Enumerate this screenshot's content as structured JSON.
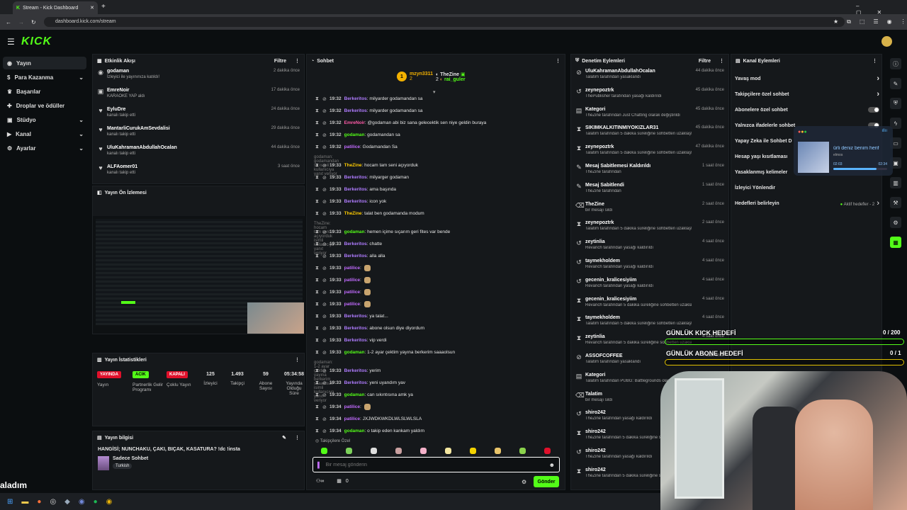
{
  "browser": {
    "tab_title": "Stream - Kick Dashboard",
    "url": "dashboard.kick.com/stream"
  },
  "app": {
    "logo": "KICK"
  },
  "nav": [
    {
      "label": "Yayın",
      "chev": ""
    },
    {
      "label": "Para Kazanma",
      "chev": "⌄"
    },
    {
      "label": "Başarılar",
      "chev": ""
    },
    {
      "label": "Droplar ve ödüller",
      "chev": ""
    },
    {
      "label": "Stüdyo",
      "chev": "⌄"
    },
    {
      "label": "Kanal",
      "chev": "⌄"
    },
    {
      "label": "Ayarlar",
      "chev": "⌄"
    }
  ],
  "activity": {
    "title": "Etkinlik Akışı",
    "filter": "Filtre",
    "items": [
      {
        "name": "godaman",
        "sub": "İzleyici ile yayınınıza katıldı!",
        "time": "2 dakika önce"
      },
      {
        "name": "EmreNoir",
        "sub": "KARAOKE YAP aldı",
        "time": "17 dakika önce"
      },
      {
        "name": "EyluDre",
        "sub": "kanalı takip etti",
        "time": "24 dakika önce"
      },
      {
        "name": "MantarliCurukAmSevdalisi",
        "sub": "kanalı takip etti",
        "time": "29 dakika önce"
      },
      {
        "name": "UluKahramanAbdullahOcalan",
        "sub": "kanalı takip etti",
        "time": "44 dakika önce"
      },
      {
        "name": "ALFAomer01",
        "sub": "kanalı takip etti",
        "time": "3 saat önce"
      }
    ]
  },
  "preview": {
    "title": "Yayın Ön İzlemesi"
  },
  "stats": {
    "title": "Yayın İstatistikleri",
    "items": [
      {
        "value": "YAYINDA",
        "label": "Yayın",
        "type": "red"
      },
      {
        "value": "ACIK",
        "label": "Partnerlik Gelir Programı",
        "type": "green"
      },
      {
        "value": "KAPALI",
        "label": "Çoklu Yayın",
        "type": "red"
      },
      {
        "value": "125",
        "label": "İzleyici",
        "type": "num"
      },
      {
        "value": "1.493",
        "label": "Takipçi",
        "type": "num"
      },
      {
        "value": "59",
        "label": "Abone Sayısı",
        "type": "num"
      },
      {
        "value": "05:34:58",
        "label": "Yayında Olduğu Süre",
        "type": "num"
      }
    ]
  },
  "info": {
    "title": "Yayın bilgisi",
    "stream_title": "HANGİSİ; NUNCHAKU, ÇAKI, BIÇAK, KASATURA? !dc !insta",
    "category": "Sadece Sohbet",
    "tag": "Turkish"
  },
  "chat": {
    "title": "Sohbet",
    "top1_name": "mzyn3311",
    "top1_count": "2",
    "top2_name": "TheZine",
    "top2_count": "2",
    "top3_name": "rai_guler",
    "top3_count": "2",
    "messages": [
      {
        "time": "19:32",
        "user": "Berkeritos",
        "color": "#b07cff",
        "text": ": milyarder godamandan sa"
      },
      {
        "time": "19:32",
        "user": "Berkeritos",
        "color": "#b07cff",
        "text": ": milyarder godamandan sa"
      },
      {
        "time": "19:32",
        "user": "EmreNoir",
        "color": "#ff5ba8",
        "text": ": @godaman abi biz sana gelecektik sen niye geldin buraya"
      },
      {
        "time": "19:32",
        "user": "godaman",
        "color": "#53fc18",
        "text": ": godamandan sa"
      },
      {
        "time": "19:32",
        "user": "patilice",
        "color": "#c26bff",
        "text": ": Godamandan Sa"
      },
      {
        "sys": "godaman: godamandan sa isimli kullanıcıya yanıt veriyor"
      },
      {
        "time": "19:33",
        "user": "TheZine",
        "color": "#ffcc00",
        "text": ": hocam tam seni açıyorduk"
      },
      {
        "time": "19:33",
        "user": "Berkeritos",
        "color": "#b07cff",
        "text": ": milyarger godaman"
      },
      {
        "time": "19:33",
        "user": "Berkeritos",
        "color": "#b07cff",
        "text": ": ama başında"
      },
      {
        "time": "19:33",
        "user": "Berkeritos",
        "color": "#b07cff",
        "text": ": icon yok"
      },
      {
        "time": "19:33",
        "user": "TheZine",
        "color": "#ffcc00",
        "text": ": talat ben godamanda modum"
      },
      {
        "sys": "TheZine: hocam tam seni açıyorduk isimli kullanıcıya yanıt veriyor"
      },
      {
        "time": "19:33",
        "user": "godaman",
        "color": "#53fc18",
        "text": ": hemen içime sıçarım geri fites var bende"
      },
      {
        "time": "19:33",
        "user": "Berkeritos",
        "color": "#b07cff",
        "text": ": chatte"
      },
      {
        "time": "19:33",
        "user": "Berkeritos",
        "color": "#b07cff",
        "text": ": alla alla"
      },
      {
        "time": "19:33",
        "user": "patilice",
        "color": "#c26bff",
        "text": ":"
      },
      {
        "time": "19:33",
        "user": "patilice",
        "color": "#c26bff",
        "text": ":"
      },
      {
        "time": "19:33",
        "user": "patilice",
        "color": "#c26bff",
        "text": ":"
      },
      {
        "time": "19:33",
        "user": "patilice",
        "color": "#c26bff",
        "text": ":"
      },
      {
        "time": "19:33",
        "user": "Berkeritos",
        "color": "#b07cff",
        "text": ": ya talat..."
      },
      {
        "time": "19:33",
        "user": "Berkeritos",
        "color": "#b07cff",
        "text": ": abone olsun diye diyordum"
      },
      {
        "time": "19:33",
        "user": "Berkeritos",
        "color": "#b07cff",
        "text": ": vip verdi"
      },
      {
        "time": "19:33",
        "user": "godaman",
        "color": "#53fc18",
        "text": ": 1-2 ayar çektim yayına berkerim saaaolsun"
      },
      {
        "sys": "godaman: 1-2 ayar çektim yayına berkerim saaaolsun isimli kullanıcıya yanıt veriyor"
      },
      {
        "time": "19:33",
        "user": "Berkeritos",
        "color": "#b07cff",
        "text": ": yerim"
      },
      {
        "time": "19:33",
        "user": "Berkeritos",
        "color": "#b07cff",
        "text": ": yeni uyandım yav"
      },
      {
        "time": "19:33",
        "user": "godaman",
        "color": "#53fc18",
        "text": ": can sıkıntısına amk ya"
      },
      {
        "time": "19:34",
        "user": "patilice",
        "color": "#c26bff",
        "text": ":"
      },
      {
        "time": "19:34",
        "user": "patilice",
        "color": "#c26bff",
        "text": ": JXJWDKWKDLWLSLWLSLA"
      },
      {
        "time": "19:34",
        "user": "godaman",
        "color": "#53fc18",
        "text": ": o takip eden kankam yaldım"
      }
    ],
    "followers_only": "Takipçilere Özel",
    "input_placeholder": "Bir mesaj gönderin",
    "send": "Gönder",
    "count1": "0",
    "count2": "0"
  },
  "mod": {
    "title": "Denetim Eylemleri",
    "filter": "Filtre",
    "items": [
      {
        "name": "UluKahramanAbdullahOcalan",
        "sub": "Talatim tarafından yasaklandı",
        "time": "44 dakika önce",
        "icon": "⊘"
      },
      {
        "name": "zeynepoztrk",
        "sub": "ThePublisher tarafından yasağı kaldırıldı",
        "time": "45 dakika önce",
        "icon": "↺"
      },
      {
        "name": "Kategori",
        "sub": "TheZine tarafından Just Chatting olarak değiştirildi",
        "time": "45 dakika önce",
        "icon": "▤"
      },
      {
        "name": "SIKIMKALKITINMIYOKIZLAR31",
        "sub": "Talatim tarafından 5 dakika süreliğine sohbetten uzaklaştırıldı",
        "time": "45 dakika önce",
        "icon": "⧗"
      },
      {
        "name": "zeynepoztrk",
        "sub": "Talatim tarafından 5 dakika süreliğine sohbetten uzaklaştırıldı",
        "time": "47 dakika önce",
        "icon": "⧗"
      },
      {
        "name": "Mesaj Sabitlemesi Kaldırıldı",
        "sub": "TheZine tarafından",
        "time": "1 saat önce",
        "icon": "✎"
      },
      {
        "name": "Mesaj Sabitlendi",
        "sub": "TheZine tarafından",
        "time": "1 saat önce",
        "icon": "✎"
      },
      {
        "name": "TheZine",
        "sub": "bir mesajı sildi",
        "time": "2 saat önce",
        "icon": "🗑"
      },
      {
        "name": "zeynepoztrk",
        "sub": "Talatim tarafından 5 dakika süreliğine sohbetten uzaklaştırıldı",
        "time": "2 saat önce",
        "icon": "⧗"
      },
      {
        "name": "zeytinlia",
        "sub": "Revanch tarafından yasağı kaldırıldı",
        "time": "4 saat önce",
        "icon": "↺"
      },
      {
        "name": "taymekholdem",
        "sub": "Revanch tarafından yasağı kaldırıldı",
        "time": "4 saat önce",
        "icon": "↺"
      },
      {
        "name": "gecenin_kralicesiyiim",
        "sub": "Revanch tarafından yasağı kaldırıldı",
        "time": "4 saat önce",
        "icon": "↺"
      },
      {
        "name": "gecenin_kralicesiyiim",
        "sub": "Revanch tarafından 5 dakika süreliğine sohbetten uzaklaştırıldı",
        "time": "4 saat önce",
        "icon": "⧗"
      },
      {
        "name": "taymekholdem",
        "sub": "Talatim tarafından 5 dakika süreliğine sohbetten uzaklaştırıldı",
        "time": "4 saat önce",
        "icon": "⧗"
      },
      {
        "name": "zeytinlia",
        "sub": "Revanch tarafından 5 dakika süreliğine sohbetten uzaklaştırıldı",
        "time": "4 saat önce",
        "icon": "⧗"
      },
      {
        "name": "ASSOFCOFFEE",
        "sub": "Talatim tarafından yasaklandı",
        "time": "4 saat önce",
        "icon": "⊘"
      },
      {
        "name": "Kategori",
        "sub": "Talatim tarafından PUBG: Battlegrounds olarak değiştirildi",
        "time": "",
        "icon": "▤"
      },
      {
        "name": "Talatim",
        "sub": "bir mesajı sildi",
        "time": "",
        "icon": "🗑"
      },
      {
        "name": "shiro242",
        "sub": "TheZine tarafından yasağı kaldırıldı",
        "time": "",
        "icon": "↺"
      },
      {
        "name": "shiro242",
        "sub": "TheZine tarafından 5 dakika süreliğine sohbetten uzaklaştırıldı",
        "time": "",
        "icon": "⧗"
      },
      {
        "name": "shiro242",
        "sub": "TheZine tarafından yasağı kaldırıldı",
        "time": "",
        "icon": "↺"
      },
      {
        "name": "shiro242",
        "sub": "TheZine tarafından 5 dakika süreliğine sohbetten uzaklaştırıldı",
        "time": "",
        "icon": "⧗"
      }
    ]
  },
  "channel": {
    "title": "Kanal Eylemleri",
    "items": [
      {
        "label": "Yavaş mod",
        "kind": "arrow"
      },
      {
        "label": "Takipçilere özel sohbet",
        "kind": "arrow"
      },
      {
        "label": "Abonelere özel sohbet",
        "kind": "toggle"
      },
      {
        "label": "Yalnızca ifadelerle sohbet",
        "kind": "toggle"
      },
      {
        "label": "Yapay Zeka ile Sohbet D",
        "kind": "none"
      },
      {
        "label": "Hesap yaşı kısıtlaması",
        "kind": "none"
      },
      {
        "label": "Yasaklanmış kelimeler",
        "kind": "none"
      },
      {
        "label": "İzleyici Yönlendir",
        "kind": "none"
      },
      {
        "label": "Hedefleri belirleyin",
        "kind": "goal"
      }
    ],
    "goal_status": "Aktif hedefler - 2"
  },
  "media": {
    "title": "ürli deniz benim herif",
    "artist": "elmos",
    "time_cur": "02:03",
    "time_total": "02:34",
    "progress": 0.8
  },
  "goals": {
    "kick_label": "GÜNLÜK KICK HEDEFİ",
    "kick_value": "0 / 200",
    "sub_label": "GÜNLÜK ABONE HEDEFİ",
    "sub_value": "0 / 1"
  },
  "overlay_text": "aladım",
  "colors": {
    "accent": "#53fc18",
    "bg": "#0b0e10",
    "panel": "#15181b",
    "live": "#e0102b"
  }
}
